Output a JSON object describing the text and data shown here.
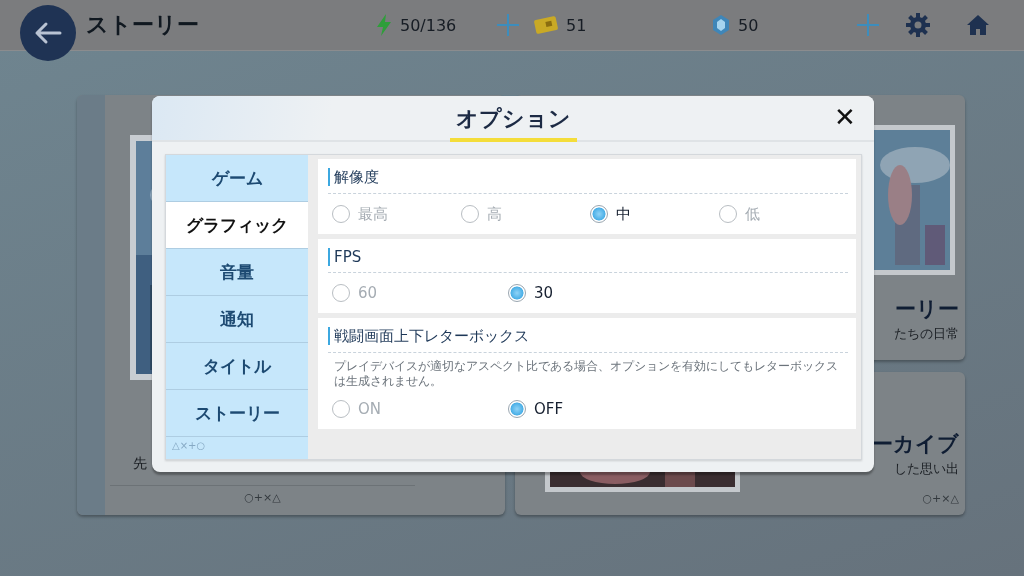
{
  "top_bar": {
    "title": "ストーリー",
    "resources": [
      {
        "kind": "stamina",
        "value": "50/136",
        "plus": true
      },
      {
        "kind": "ticket",
        "value": "51",
        "plus": false
      },
      {
        "kind": "crystal",
        "value": "50",
        "plus": true
      }
    ]
  },
  "background_cards": {
    "left": {
      "subtitle": "先",
      "marks": "○+×△"
    },
    "right": [
      {
        "title": "ーリー",
        "subtitle": "たちの日常"
      },
      {
        "title": "ーカイブ",
        "subtitle": "した思い出",
        "marks": "○+×△"
      }
    ]
  },
  "dialog": {
    "title": "オプション",
    "close": "✕",
    "menu_marks": "△×+○",
    "menu": [
      {
        "label": "ゲーム",
        "selected": false
      },
      {
        "label": "グラフィック",
        "selected": true
      },
      {
        "label": "音量",
        "selected": false
      },
      {
        "label": "通知",
        "selected": false
      },
      {
        "label": "タイトル",
        "selected": false
      },
      {
        "label": "ストーリー",
        "selected": false
      }
    ],
    "sections": [
      {
        "title": "解像度",
        "options": [
          {
            "label": "最高",
            "selected": false
          },
          {
            "label": "高",
            "selected": false
          },
          {
            "label": "中",
            "selected": true
          },
          {
            "label": "低",
            "selected": false
          }
        ]
      },
      {
        "title": "FPS",
        "options": [
          {
            "label": "60",
            "selected": false
          },
          {
            "label": "30",
            "selected": true
          }
        ]
      },
      {
        "title": "戦闘画面上下レターボックス",
        "description": "プレイデバイスが適切なアスペクト比である場合、オプションを有効にしてもレターボックスは生成されません。",
        "options": [
          {
            "label": "ON",
            "selected": false
          },
          {
            "label": "OFF",
            "selected": true
          }
        ]
      }
    ]
  }
}
